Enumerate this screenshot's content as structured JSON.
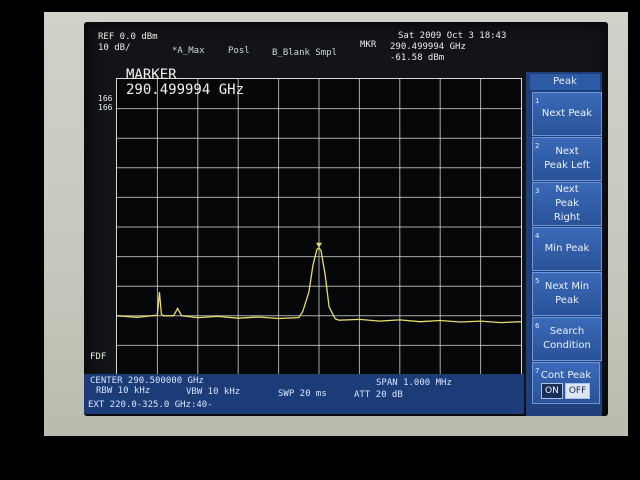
{
  "header": {
    "ref_level": "REF 0.0 dBm",
    "scale": "10 dB/",
    "trace_mode": "*A_Max",
    "pos": "Posl",
    "blank": "B_Blank Smpl",
    "mkr_label": "MKR",
    "mkr_freq": "290.499994 GHz",
    "mkr_amp": "-61.58 dBm",
    "datetime": "Sat 2009 Oct  3 18:43"
  },
  "marker_box": {
    "title": "MARKER",
    "value": "290.499994 GHz"
  },
  "side_labels": {
    "l1": "166",
    "l2": "166",
    "fdf": "FDF"
  },
  "footer": {
    "center": "CENTER 290.500000 GHz",
    "span": "SPAN 1.000 MHz",
    "rbw": "RBW 10 kHz",
    "vbw": "VBW 10 kHz",
    "swp": "SWP 20 ms",
    "att": "ATT 20 dB",
    "ext": "EXT 220.0-325.0 GHz:40-"
  },
  "softkeys": {
    "title": "Peak",
    "items": [
      {
        "num": "1",
        "label": "Next Peak"
      },
      {
        "num": "2",
        "label": "Next Peak Left"
      },
      {
        "num": "3",
        "label": "Next Peak Right"
      },
      {
        "num": "4",
        "label": "Min Peak"
      },
      {
        "num": "5",
        "label": "Next Min Peak"
      },
      {
        "num": "6",
        "label": "Search Condition"
      },
      {
        "num": "7",
        "label": "Cont Peak",
        "on": "ON",
        "off": "OFF"
      }
    ]
  },
  "chart_data": {
    "type": "line",
    "xlim": [
      0,
      10
    ],
    "ylim": [
      -100,
      0
    ],
    "grid_divisions": {
      "x": 10,
      "y": 10
    },
    "series": [
      {
        "x": [
          0,
          0.5,
          1.0,
          1.05,
          1.1,
          1.15,
          1.4,
          1.5,
          1.6,
          2.0,
          2.5,
          3.0,
          3.5,
          4.0,
          4.5,
          4.6,
          4.75,
          4.85,
          4.95,
          5.0,
          5.05,
          5.15,
          5.25,
          5.4,
          5.5,
          6.0,
          6.5,
          7.0,
          7.5,
          8.0,
          8.5,
          9.0,
          9.5,
          10.0
        ],
        "y": [
          -80,
          -80.5,
          -79.8,
          -72,
          -79.5,
          -80,
          -80,
          -77.5,
          -80,
          -80.6,
          -80.2,
          -80.8,
          -80.4,
          -80.9,
          -80.6,
          -78.5,
          -72,
          -63,
          -57.5,
          -57,
          -58,
          -66,
          -77,
          -81,
          -81.5,
          -81.2,
          -81.8,
          -81.4,
          -82,
          -81.6,
          -82.1,
          -81.8,
          -82.3,
          -82
        ]
      }
    ],
    "marker": {
      "x": 5.0,
      "y": -57
    }
  },
  "colors": {
    "trace": "#e8dc6a",
    "grid": "#dfe3df",
    "softkey": "#3a6ab8",
    "bar": "#1c3c78"
  }
}
